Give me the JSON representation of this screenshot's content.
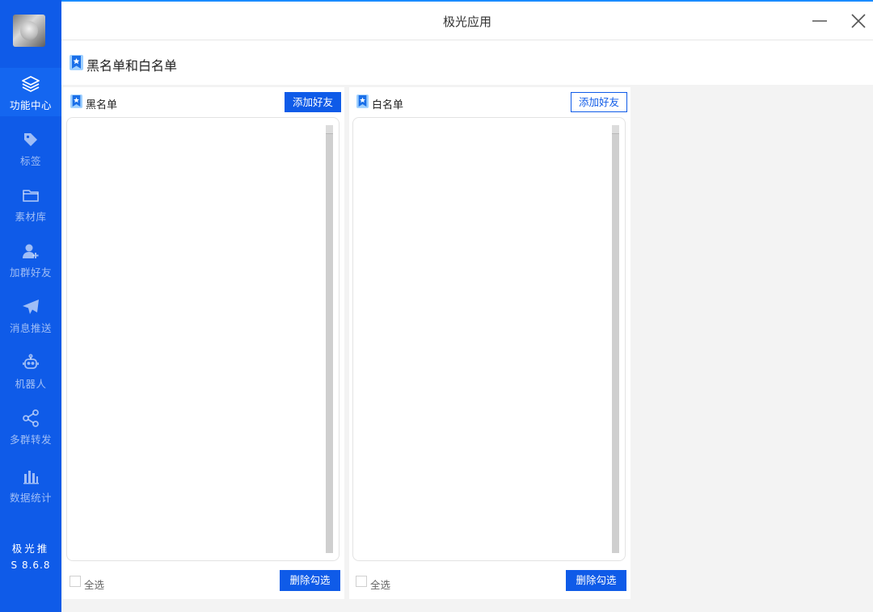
{
  "window": {
    "title": "极光应用"
  },
  "sidebar": {
    "items": [
      {
        "label": "功能中心",
        "icon": "layers-icon",
        "active": true
      },
      {
        "label": "标签",
        "icon": "tag-icon",
        "active": false
      },
      {
        "label": "素材库",
        "icon": "folder-icon",
        "active": false
      },
      {
        "label": "加群好友",
        "icon": "add-user-icon",
        "active": false
      },
      {
        "label": "消息推送",
        "icon": "send-icon",
        "active": false
      },
      {
        "label": "机器人",
        "icon": "robot-icon",
        "active": false
      },
      {
        "label": "多群转发",
        "icon": "share-icon",
        "active": false
      },
      {
        "label": "数据统计",
        "icon": "bar-chart-icon",
        "active": false
      }
    ],
    "brand": "极光推",
    "version": "S 8.6.8"
  },
  "page": {
    "title": "黑名单和白名单"
  },
  "blacklist": {
    "title": "黑名单",
    "add_label": "添加好友",
    "select_all_label": "全选",
    "delete_label": "删除勾选"
  },
  "whitelist": {
    "title": "白名单",
    "add_label": "添加好友",
    "select_all_label": "全选",
    "delete_label": "删除勾选"
  },
  "colors": {
    "sidebar": "#0f5be8",
    "accent": "#1a8cff",
    "button": "#0f5be8",
    "background": "#f3f3f3"
  }
}
